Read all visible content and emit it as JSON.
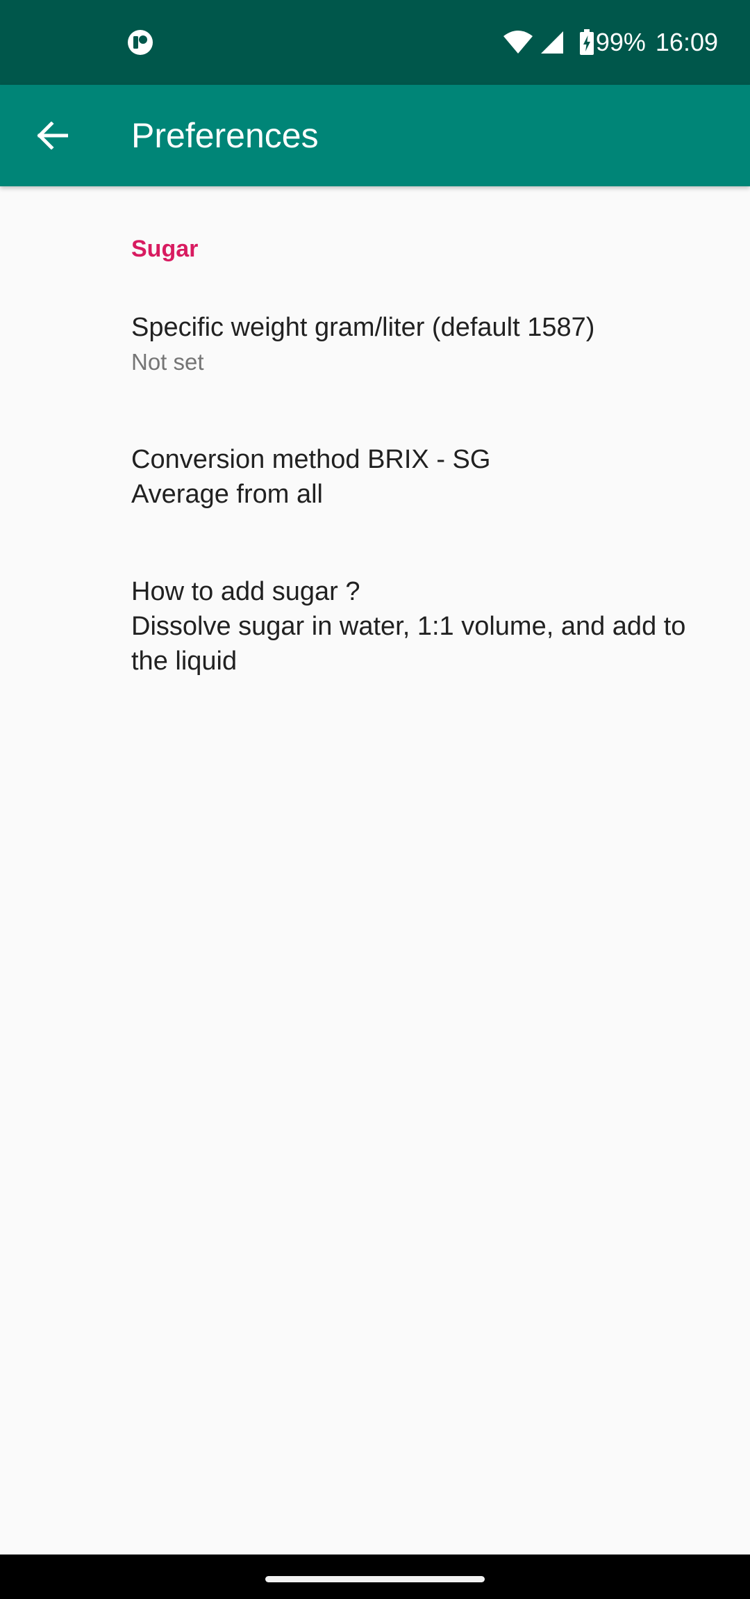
{
  "status_bar": {
    "battery": "99%",
    "time": "16:09",
    "icons": [
      "notification-app-icon",
      "wifi-icon",
      "cellular-signal-icon",
      "battery-charging-icon"
    ]
  },
  "toolbar": {
    "back_icon": "arrow-back-icon",
    "title": "Preferences"
  },
  "preferences": {
    "category": "Sugar",
    "items": [
      {
        "title": "Specific weight gram/liter (default 1587)",
        "summary": "Not set"
      },
      {
        "title": "Conversion method BRIX - SG",
        "summary": "Average from all"
      },
      {
        "title": "How to add sugar ?",
        "summary": "Dissolve sugar in water, 1:1 volume, and add to the liquid"
      }
    ]
  },
  "colors": {
    "status_bar": "#00574b",
    "app_bar": "#008577",
    "category_accent": "#d81b60",
    "background": "#fafafa",
    "primary_text": "#212121",
    "secondary_text": "#757575"
  }
}
